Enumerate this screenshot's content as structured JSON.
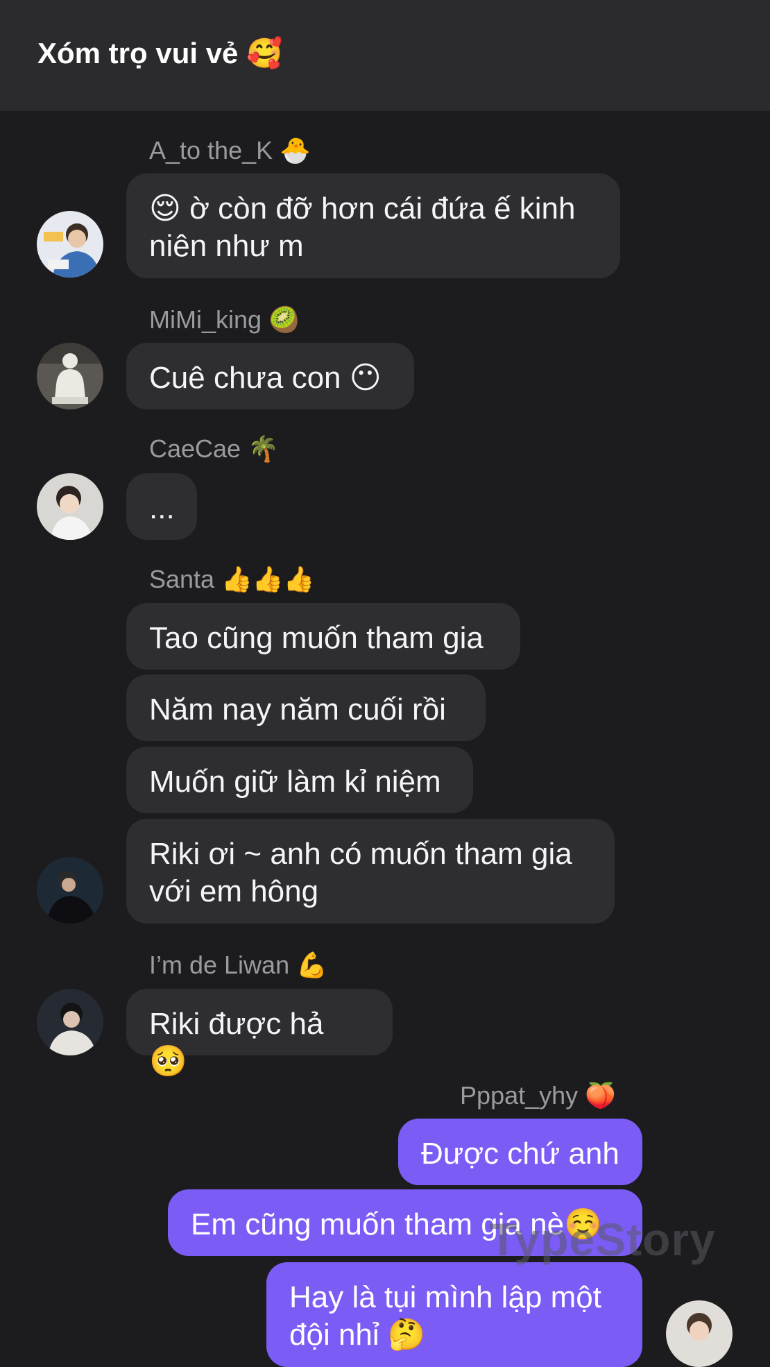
{
  "header": {
    "title": "Xóm trọ vui vẻ",
    "title_emoji": "🥰"
  },
  "messages": [
    {
      "sender": "A_to the_K",
      "sender_emoji": "🐣",
      "lines": [
        "😌 ờ còn đỡ hơn cái đứa ế kinh niên như m"
      ],
      "avatar": "avatar-a-to-the-k"
    },
    {
      "sender": "MiMi_king",
      "sender_emoji": "🥝",
      "lines": [
        "Cuê chưa con 😶"
      ],
      "avatar": "avatar-mimi-king"
    },
    {
      "sender": "CaeCae",
      "sender_emoji": "🌴",
      "lines": [
        "..."
      ],
      "avatar": "avatar-caecae"
    },
    {
      "sender": "Santa",
      "sender_emoji": "👍👍👍",
      "lines": [
        "Tao cũng muốn tham gia",
        "Năm nay năm cuối rồi",
        "Muốn giữ làm kỉ niệm",
        "Riki ơi ~ anh có muốn tham gia với em hông"
      ],
      "avatar": "avatar-santa"
    },
    {
      "sender": "I’m de Liwan",
      "sender_emoji": "💪",
      "lines": [
        "Riki được hả 🥺"
      ],
      "avatar": "avatar-liwan"
    },
    {
      "sender": "Pppat_yhy",
      "sender_emoji": "🍑",
      "lines": [
        "Được chứ anh",
        "Em cũng muốn tham gia nè☺️",
        "Hay là tụi mình lập một đội nhỉ 🤔"
      ],
      "avatar": "avatar-pppat-yhy",
      "mine": true
    }
  ],
  "watermark": "TypeStory",
  "colors": {
    "background": "#1c1c1e",
    "header": "#2b2b2d",
    "bubble_other": "#2e2e31",
    "bubble_mine": "#7b5cf5",
    "sender_text": "#9a9aa0"
  }
}
